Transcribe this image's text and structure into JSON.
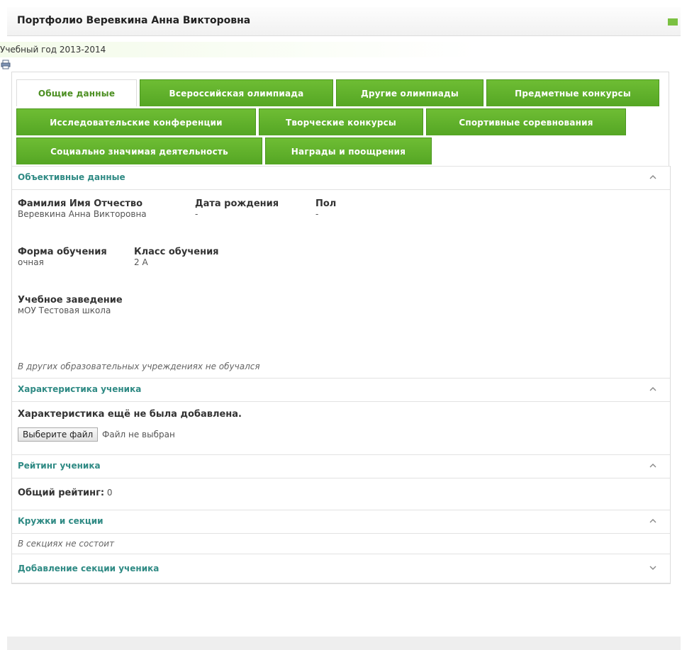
{
  "header": {
    "title": "Портфолио Веревкина Анна Викторовна"
  },
  "year_label": "Учебный год 2013-2014",
  "tabs": {
    "row1": [
      "Общие данные",
      "Всероссийская олимпиада",
      "Другие олимпиады",
      "Предметные конкурсы"
    ],
    "row2": [
      "Исследовательские конференции",
      "Творческие конкурсы",
      "Спортивные соревнования"
    ],
    "row3": [
      "Социально значимая деятельность",
      "Награды и поощрения"
    ]
  },
  "sections": {
    "objective": {
      "title": "Объективные данные",
      "fio_label": "Фамилия Имя Отчество",
      "fio_value": "Веревкина Анна Викторовна",
      "dob_label": "Дата рождения",
      "dob_value": "-",
      "sex_label": "Пол",
      "sex_value": "-",
      "form_label": "Форма обучения",
      "form_value": "очная",
      "class_label": "Класс обучения",
      "class_value": "2 А",
      "school_label": "Учебное заведение",
      "school_value": "мОУ Тестовая школа",
      "note": "В других образовательных учреждениях не обучался"
    },
    "characteristic": {
      "title": "Характеристика ученика",
      "status": "Характеристика ещё не была добавлена.",
      "file_button": "Выберите файл",
      "file_status": "Файл не выбран"
    },
    "rating": {
      "title": "Рейтинг ученика",
      "label": "Общий рейтинг:",
      "value": "0"
    },
    "clubs": {
      "title": "Кружки и секции",
      "note": "В секциях не состоит"
    },
    "add_club": {
      "title": "Добавление секции ученика"
    }
  },
  "colors": {
    "tab_green": "#5cae2a",
    "section_title": "#2f8a84"
  },
  "icons": {
    "print": "printer-icon",
    "collapse": "chevron-up-icon",
    "expand": "chevron-down-icon"
  }
}
